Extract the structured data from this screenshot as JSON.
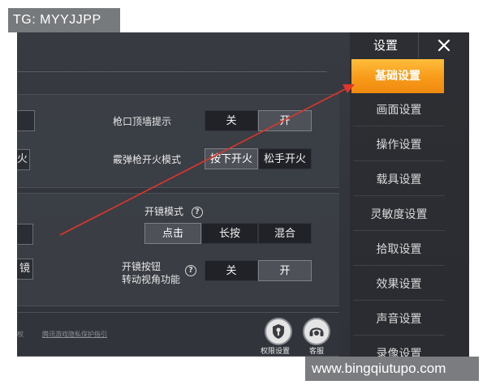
{
  "watermarks": {
    "top": "TG: MYYJJPP",
    "bottom": "www.bingqiutupo.com"
  },
  "colors": {
    "accent": "#f79a18",
    "annotation_arrow": "#e0352b",
    "toggle_on": "#4e5158",
    "toggle_off": "#202227"
  },
  "panel1": {
    "fire_stub_label": "火",
    "muzzle_wall_hint": {
      "label": "枪口顶墙提示",
      "options": [
        "关",
        "开"
      ],
      "selected": "开"
    },
    "shotgun_fire_mode": {
      "label": "霰弹枪开火模式",
      "options": [
        "按下开火",
        "松手开火"
      ],
      "selected": "按下开火"
    }
  },
  "panel2": {
    "scope_stub_label": "镜",
    "scope_mode": {
      "label": "开镜模式",
      "help_icon": "question-circle-icon",
      "options": [
        "点击",
        "长按",
        "混合"
      ],
      "selected": "点击"
    },
    "scope_button_rotate": {
      "label_line1": "开镜按钮",
      "label_line2": "转动视角功能",
      "help_icon": "question-circle-icon",
      "options": [
        "关",
        "开"
      ],
      "selected": "开"
    }
  },
  "footer": {
    "left_text": "权",
    "privacy_link": "腾讯游戏隐私保护指引",
    "permission_settings": {
      "icon": "shield-key-icon",
      "label": "权限设置"
    },
    "customer_service": {
      "icon": "headset-icon",
      "label": "客服"
    }
  },
  "sidebar": {
    "title": "设置",
    "close_icon": "close-icon",
    "items": [
      {
        "label": "基础设置",
        "active": true
      },
      {
        "label": "画面设置",
        "active": false
      },
      {
        "label": "操作设置",
        "active": false
      },
      {
        "label": "载具设置",
        "active": false
      },
      {
        "label": "灵敏度设置",
        "active": false
      },
      {
        "label": "拾取设置",
        "active": false
      },
      {
        "label": "效果设置",
        "active": false
      },
      {
        "label": "声音设置",
        "active": false
      },
      {
        "label": "录像设置",
        "active": false
      }
    ]
  }
}
